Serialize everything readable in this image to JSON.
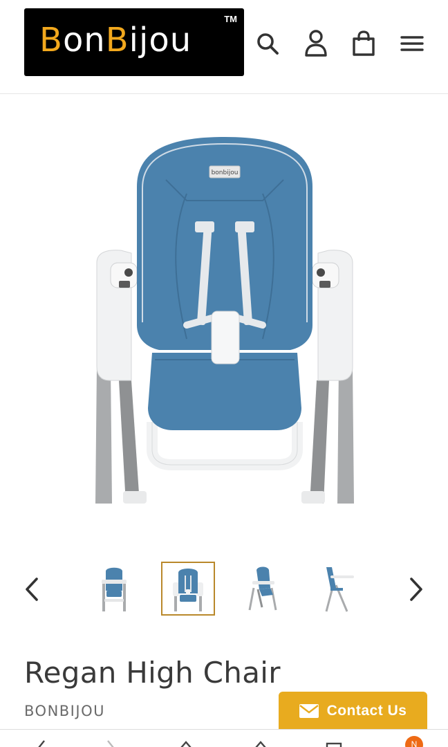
{
  "header": {
    "logo": {
      "text_part1": "B",
      "text_part2": "on",
      "text_part3": "B",
      "text_part4": "ijou",
      "trademark": "TM"
    },
    "icons": [
      "search-icon",
      "account-icon",
      "cart-icon",
      "menu-icon"
    ]
  },
  "product": {
    "title": "Regan High Chair",
    "vendor": "BONBIJOU",
    "seat_badge": "bonbijou"
  },
  "gallery": {
    "thumbnails": [
      "thumbnail-front",
      "thumbnail-seat-closeup",
      "thumbnail-angle",
      "thumbnail-side"
    ],
    "active_index": 1
  },
  "contact": {
    "label": "Contact Us"
  },
  "bottom_bar": {
    "badge": "N"
  },
  "colors": {
    "accent": "#e8ab1f",
    "seat_blue": "#4b82ad",
    "thumb_border": "#b9882a",
    "badge": "#ee6a14"
  }
}
